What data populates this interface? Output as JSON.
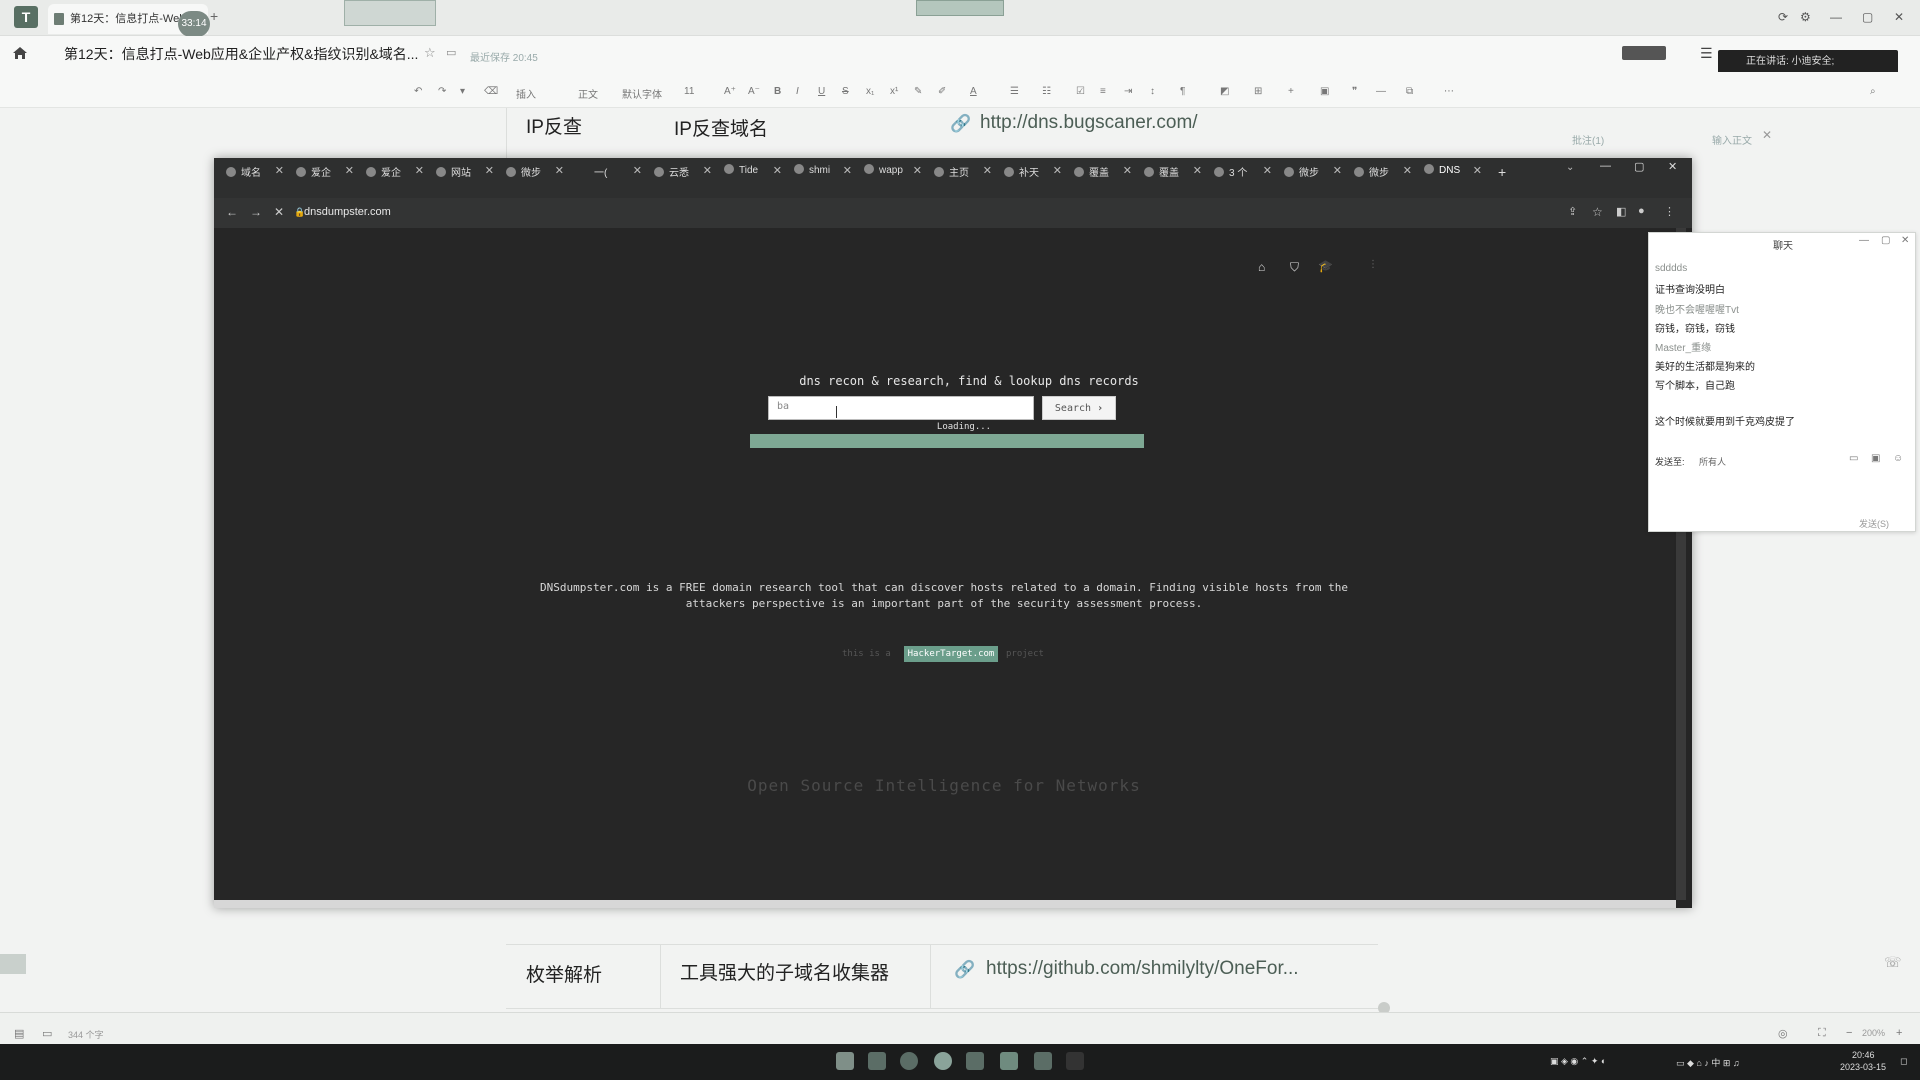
{
  "editor": {
    "tab_title": "第12天：信息打点-Web...",
    "timer": "33:14",
    "doc_title": "第12天：信息打点-Web应用&企业产权&指纹识别&域名...",
    "saved": "最近保存 20:45",
    "speaking": "正在讲话: 小迪安全;",
    "zoom": "200%",
    "word_count": "344 个字",
    "toolbar": {
      "insert": "插入",
      "body_text": "正文",
      "default_font": "默认字体",
      "font_size": "11"
    },
    "table_top": {
      "c1": "IP反查",
      "c2": "IP反查域名",
      "c3": "http://dns.bugscaner.com/"
    },
    "table_bottom": {
      "c1": "枚举解析",
      "c2": "工具强大的子域名收集器",
      "c3": "https://github.com/shmilylty/OneFor..."
    },
    "right_note": "批注(1)",
    "right_note2": "输入正文"
  },
  "browser": {
    "tabs": [
      "域名",
      "爱企",
      "爱企",
      "网站",
      "微步",
      "一(",
      "云悉",
      "Tide",
      "shmi",
      "wapp",
      "主页",
      "补天",
      "覆盖",
      "覆盖",
      "3 个",
      "微步",
      "微步",
      "DNS"
    ],
    "url": "dnsdumpster.com",
    "page": {
      "heading": "dns recon & research, find & lookup dns records",
      "input_value": "ba",
      "search_label": "Search",
      "loading": "Loading...",
      "description_1": "DNSdumpster.com is a FREE domain research tool that can discover hosts related to a domain. Finding visible hosts from the",
      "description_2": "attackers perspective is an important part of the security assessment process.",
      "project_prefix": "this is a",
      "hackertarget": "HackerTarget.com",
      "project_suffix": "project",
      "footer": "Open Source Intelligence for Networks"
    }
  },
  "chat": {
    "title": "聊天",
    "messages": [
      {
        "kind": "name",
        "text": "sdddds"
      },
      {
        "kind": "msg",
        "text": "证书查询没明白"
      },
      {
        "kind": "name",
        "text": "晚也不会喔喔喔Tvt"
      },
      {
        "kind": "msg",
        "text": "窃钱，窃钱，窃钱"
      },
      {
        "kind": "name",
        "text": "Master_重缘"
      },
      {
        "kind": "msg",
        "text": "美好的生活都是狗来的"
      },
      {
        "kind": "msg",
        "text": "写个脚本，自己跑"
      },
      {
        "kind": "msg",
        "text": ""
      },
      {
        "kind": "msg",
        "text": "这个时候就要用到千克鸡皮提了"
      }
    ],
    "send_to_label": "发送至:",
    "send_to_value": "所有人",
    "send_button": "发送(S)"
  },
  "taskbar": {
    "time": "20:46",
    "date": "2023-03-15"
  }
}
